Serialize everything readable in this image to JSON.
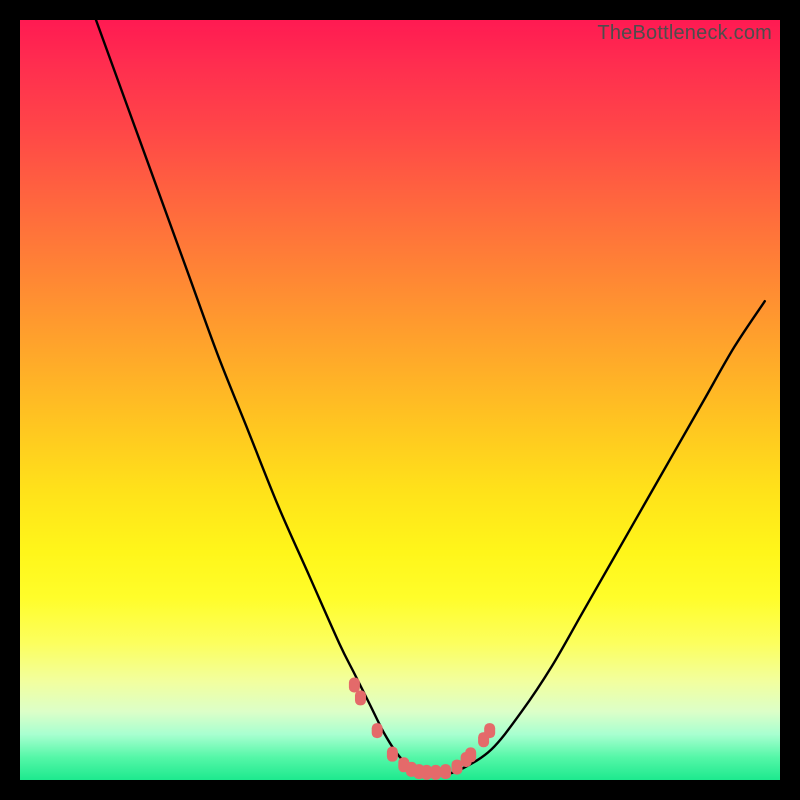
{
  "watermark": "TheBottleneck.com",
  "chart_data": {
    "type": "line",
    "title": "",
    "xlabel": "",
    "ylabel": "",
    "xlim": [
      0,
      100
    ],
    "ylim": [
      0,
      100
    ],
    "grid": false,
    "legend": false,
    "series": [
      {
        "name": "bottleneck-curve",
        "color": "#000000",
        "x": [
          10,
          14,
          18,
          22,
          26,
          30,
          34,
          38,
          42,
          44,
          46,
          48,
          50,
          52,
          54,
          56,
          58,
          62,
          66,
          70,
          74,
          78,
          82,
          86,
          90,
          94,
          98
        ],
        "y": [
          100,
          89,
          78,
          67,
          56,
          46,
          36,
          27,
          18,
          14,
          10,
          6,
          3,
          1.4,
          0.8,
          0.8,
          1.4,
          4,
          9,
          15,
          22,
          29,
          36,
          43,
          50,
          57,
          63
        ]
      },
      {
        "name": "optimal-markers",
        "color": "#e46a6a",
        "type": "scatter",
        "x": [
          44.0,
          44.8,
          47.0,
          49.0,
          50.5,
          51.5,
          52.5,
          53.5,
          54.7,
          56.0,
          57.5,
          58.7,
          59.3,
          61.0,
          61.8
        ],
        "y": [
          12.5,
          10.8,
          6.5,
          3.4,
          2.0,
          1.4,
          1.1,
          1.0,
          1.0,
          1.1,
          1.7,
          2.7,
          3.3,
          5.3,
          6.5
        ]
      }
    ],
    "background_gradient": {
      "top": "#ff1a52",
      "mid": "#ffe21a",
      "bottom": "#1de98e"
    }
  }
}
